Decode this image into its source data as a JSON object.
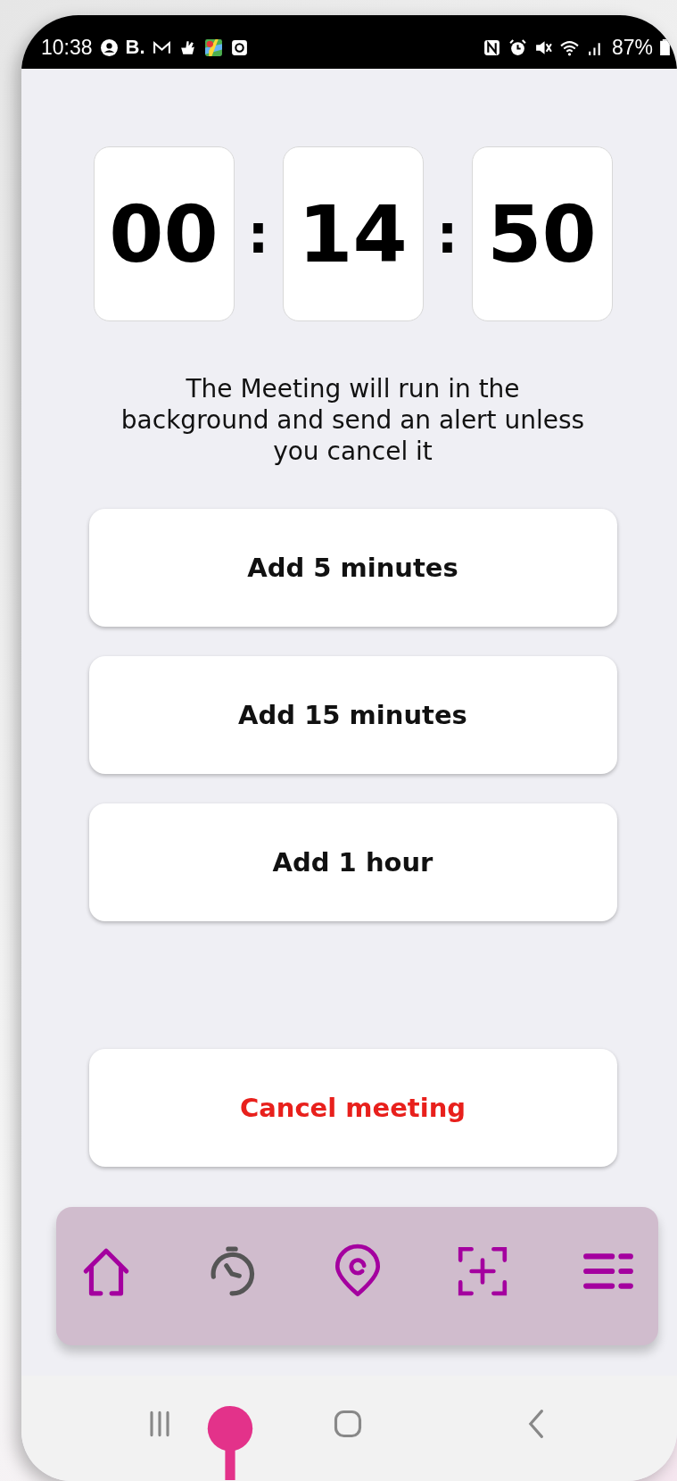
{
  "status_bar": {
    "time": "10:38",
    "app_label": "B.",
    "battery": "87%"
  },
  "timer": [
    {
      "kind": "digits",
      "text": "00"
    },
    {
      "kind": "separator",
      "text": ":"
    },
    {
      "kind": "digits",
      "text": "14"
    },
    {
      "kind": "separator",
      "text": ":"
    },
    {
      "kind": "digits",
      "text": "50"
    }
  ],
  "message": "The Meeting will run in the background and send an alert unless you cancel it",
  "actions": [
    {
      "label": "Add 5 minutes",
      "kind": "normal"
    },
    {
      "label": "Add 15 minutes",
      "kind": "normal"
    },
    {
      "label": "Add 1 hour",
      "kind": "normal"
    },
    {
      "label": "Cancel meeting",
      "kind": "destructive"
    }
  ],
  "nav": [
    {
      "kind": "home",
      "selected": false
    },
    {
      "kind": "timer",
      "selected": true
    },
    {
      "kind": "location",
      "selected": false
    },
    {
      "kind": "add",
      "selected": false
    },
    {
      "kind": "menu",
      "selected": false
    }
  ]
}
